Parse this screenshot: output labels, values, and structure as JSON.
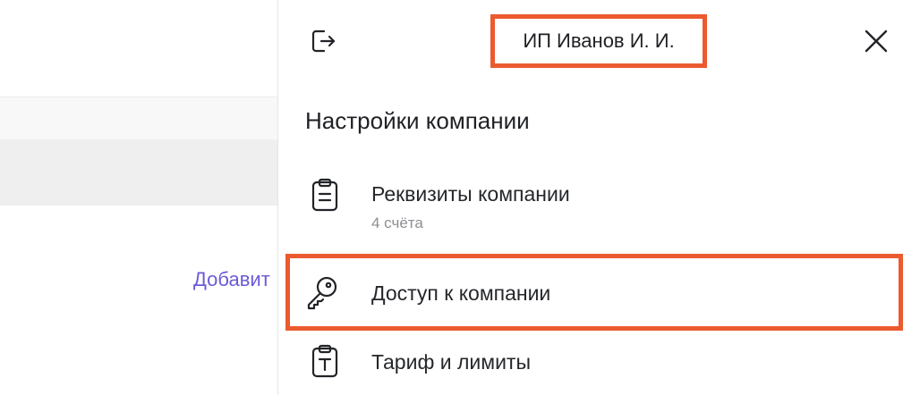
{
  "background_page": {
    "partial_link": "Добавит"
  },
  "drawer": {
    "company_name": "ИП Иванов И. И.",
    "section_title": "Настройки компании",
    "items": [
      {
        "label": "Реквизиты компании",
        "sublabel": "4 счёта",
        "icon": "clipboard-list-icon"
      },
      {
        "label": "Доступ к компании",
        "icon": "key-icon"
      },
      {
        "label": "Тариф и лимиты",
        "icon": "clipboard-t-icon"
      }
    ],
    "icons": {
      "logout": "logout-icon",
      "close": "close-icon"
    }
  },
  "colors": {
    "highlight": "#ec5a2f",
    "link": "#6b5bd6",
    "text": "#1f2024",
    "muted": "#8d8f93"
  }
}
